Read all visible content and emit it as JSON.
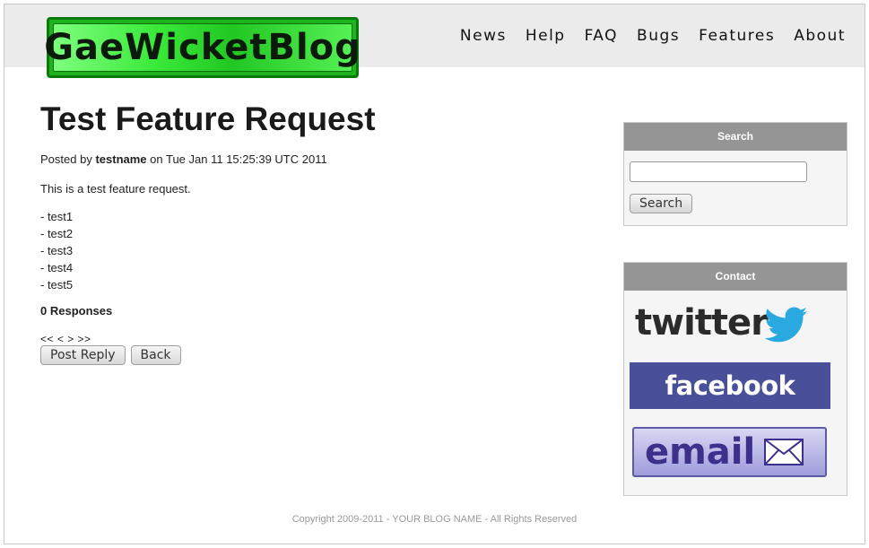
{
  "header": {
    "logo_text": "GaeWicketBlog",
    "nav": [
      "News",
      "Help",
      "FAQ",
      "Bugs",
      "Features",
      "About"
    ]
  },
  "post": {
    "title": "Test Feature Request",
    "meta_prefix": "Posted by",
    "author": "testname",
    "meta_suffix": "on Tue Jan 11 15:25:39 UTC 2011",
    "body": "This is a test feature request.",
    "list": [
      "- test1",
      "- test2",
      "- test3",
      "- test4",
      "- test5"
    ],
    "responses": "0 Responses",
    "pager": "<< < > >>",
    "post_reply_label": "Post Reply",
    "back_label": "Back"
  },
  "search": {
    "heading": "Search",
    "input_value": "",
    "button_label": "Search"
  },
  "contact": {
    "heading": "Contact",
    "twitter_text": "twitter",
    "facebook_text": "facebook",
    "email_text": "email"
  },
  "footer": {
    "copyright": "Copyright 2009-2011 - YOUR BLOG NAME - All Rights Reserved"
  },
  "colors": {
    "logo_green": "#1fb41f",
    "panel_header": "#959595",
    "facebook_blue": "#4a4f9a",
    "twitter_bird": "#2aa9e0"
  }
}
